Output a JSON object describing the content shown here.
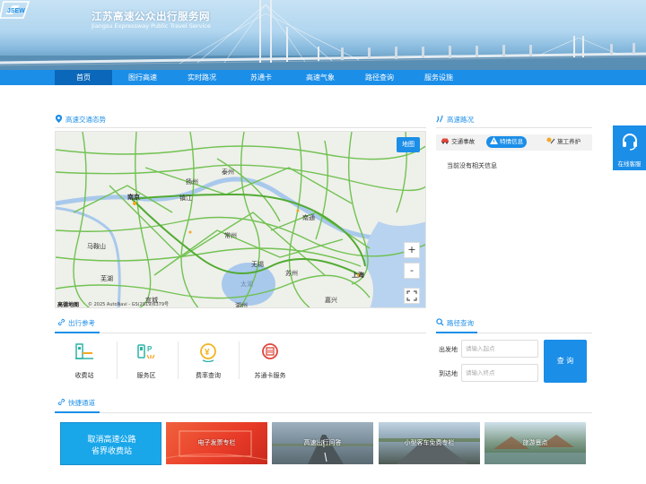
{
  "header": {
    "title": "江苏高速公众出行服务网",
    "subtitle": "Jiangsu Expressway Public Travel Service",
    "logo_text": "JSEW"
  },
  "nav": {
    "items": [
      {
        "label": "首页",
        "active": true
      },
      {
        "label": "图行高速",
        "active": false
      },
      {
        "label": "实时路况",
        "active": false
      },
      {
        "label": "苏通卡",
        "active": false
      },
      {
        "label": "高速气象",
        "active": false
      },
      {
        "label": "路径查询",
        "active": false
      },
      {
        "label": "服务设施",
        "active": false
      }
    ]
  },
  "traffic": {
    "title": "高速交通态势",
    "map_button": "地图",
    "zoom_in": "+",
    "zoom_out": "-",
    "fullscreen_icon": "fullscreen-icon",
    "map_brand": "高德地图",
    "map_copyright": "© 2025 AutoNavi - GS(2019)6379号",
    "cities": [
      "南京",
      "镇江",
      "扬州",
      "泰州",
      "南通",
      "常州",
      "无锡",
      "苏州",
      "上海",
      "马鞍山",
      "芜湖",
      "宣城",
      "湖州",
      "嘉兴",
      "太湖"
    ]
  },
  "road_status": {
    "title": "高速路况",
    "tabs": [
      {
        "label": "交通事故",
        "active": false
      },
      {
        "label": "特情信息",
        "active": true
      },
      {
        "label": "施工养护",
        "active": false
      }
    ],
    "message": "当前没有相关信息"
  },
  "online_service": {
    "label": "在线客服"
  },
  "travel_ref": {
    "title": "出行参考",
    "tiles": [
      {
        "label": "收费站",
        "icon": "toll-station-icon"
      },
      {
        "label": "服务区",
        "icon": "service-area-icon"
      },
      {
        "label": "费率查询",
        "icon": "rate-query-icon"
      },
      {
        "label": "苏通卡服务",
        "icon": "sutong-card-icon"
      }
    ]
  },
  "route_query": {
    "title": "路径查询",
    "from_label": "出发地",
    "from_placeholder": "请输入起点",
    "to_label": "到达地",
    "to_placeholder": "请输入终点",
    "button": "查 询"
  },
  "quick_links": {
    "title": "快捷通道",
    "first_line1": "取消高速公路",
    "first_line2": "省界收费站",
    "items": [
      "电子发票专栏",
      "高速出行问答",
      "小型客车免费专栏",
      "旅游景点"
    ]
  },
  "colors": {
    "primary": "#1b8ee8",
    "nav_active": "#0a67b9"
  }
}
